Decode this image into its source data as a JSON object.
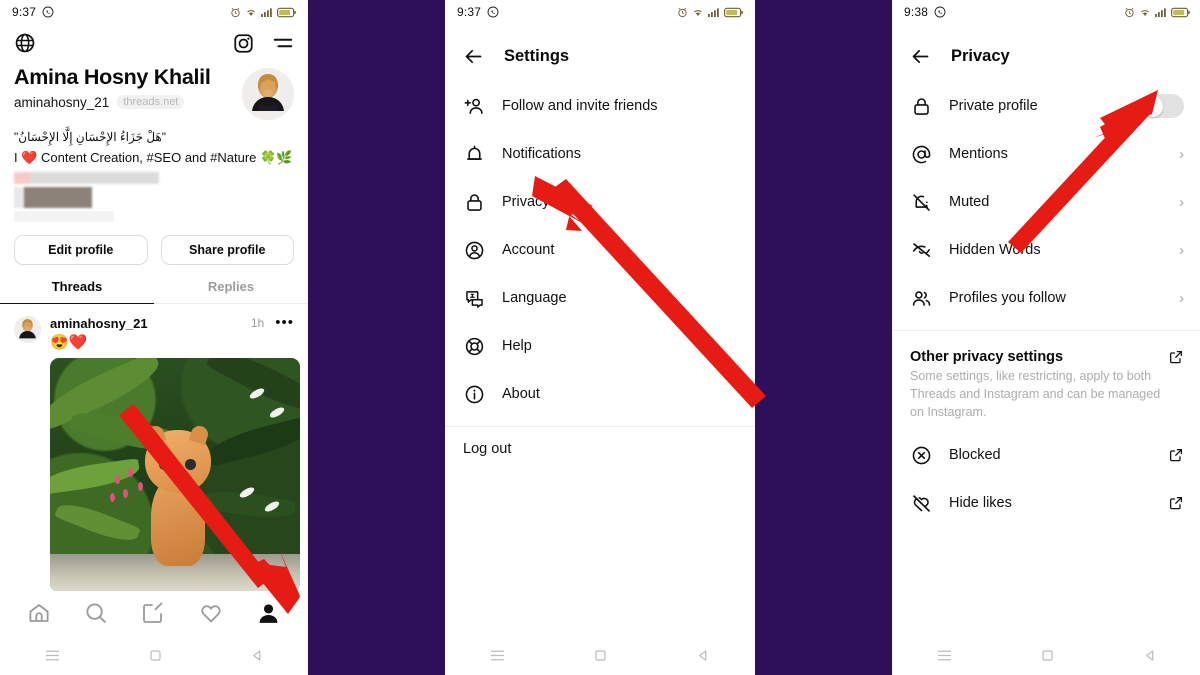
{
  "theme": {
    "background_purple": "#2d0f5a",
    "panel_white": "#ffffff",
    "arrow_red": "#e61b14",
    "accent_text": "#111111",
    "muted_text": "#adadad"
  },
  "panel_profile": {
    "status_bar": {
      "time": "9:37",
      "app_icon": "whatsapp-icon",
      "icons": [
        "alarm-icon",
        "wifi-icon",
        "signal-icon",
        "battery-icon"
      ]
    },
    "header": {
      "globe_icon": "globe-icon",
      "instagram_icon": "instagram-icon",
      "menu_icon": "hamburger-menu-icon"
    },
    "profile": {
      "display_name": "Amina Hosny Khalil",
      "username": "aminahosny_21",
      "domain_badge": "threads.net",
      "bio_arabic": "\"هَلْ جَزَاءُ الإِحْسَانِ إِلَّا الإِحْسَانُ\"",
      "bio_english": "I ❤️ Content Creation, #SEO and #Nature 🍀🌿",
      "avatar": "profile-avatar"
    },
    "buttons": {
      "edit_profile": "Edit profile",
      "share_profile": "Share profile"
    },
    "tabs": [
      {
        "label": "Threads",
        "active": true
      },
      {
        "label": "Replies",
        "active": false
      }
    ],
    "post": {
      "username": "aminahosny_21",
      "time": "1h",
      "more": "•••",
      "text": "😍❤️",
      "image": "kitten-in-garden-photo"
    },
    "bottom_nav": [
      {
        "name": "home-icon",
        "label": "Home"
      },
      {
        "name": "search-icon",
        "label": "Search"
      },
      {
        "name": "compose-icon",
        "label": "New thread"
      },
      {
        "name": "heart-icon",
        "label": "Activity"
      },
      {
        "name": "profile-icon",
        "label": "Profile"
      }
    ],
    "system_nav": [
      "recents-icon",
      "home-square-icon",
      "back-triangle-icon"
    ]
  },
  "panel_settings": {
    "status_bar": {
      "time": "9:37",
      "app_icon": "whatsapp-icon",
      "icons": [
        "alarm-icon",
        "wifi-icon",
        "signal-icon",
        "battery-icon"
      ]
    },
    "title": "Settings",
    "back_icon": "back-arrow-icon",
    "items": [
      {
        "label": "Follow and invite friends",
        "icon": "add-person-icon"
      },
      {
        "label": "Notifications",
        "icon": "bell-icon"
      },
      {
        "label": "Privacy",
        "icon": "lock-icon"
      },
      {
        "label": "Account",
        "icon": "account-circle-icon"
      },
      {
        "label": "Language",
        "icon": "language-icon"
      },
      {
        "label": "Help",
        "icon": "lifebuoy-icon"
      },
      {
        "label": "About",
        "icon": "info-circle-icon"
      }
    ],
    "log_out": "Log out",
    "system_nav": [
      "recents-icon",
      "home-square-icon",
      "back-triangle-icon"
    ]
  },
  "panel_privacy": {
    "status_bar": {
      "time": "9:38",
      "app_icon": "whatsapp-icon",
      "icons": [
        "alarm-icon",
        "wifi-icon",
        "signal-icon",
        "battery-icon"
      ]
    },
    "title": "Privacy",
    "back_icon": "back-arrow-icon",
    "items": [
      {
        "label": "Private profile",
        "icon": "lock-icon",
        "control": "toggle",
        "toggle_on": false
      },
      {
        "label": "Mentions",
        "icon": "at-sign-icon",
        "control": "chevron"
      },
      {
        "label": "Muted",
        "icon": "bell-muted-icon",
        "control": "chevron"
      },
      {
        "label": "Hidden Words",
        "icon": "eye-off-icon",
        "control": "chevron"
      },
      {
        "label": "Profiles you follow",
        "icon": "people-icon",
        "control": "chevron"
      }
    ],
    "other_section": {
      "title": "Other privacy settings",
      "description": "Some settings, like restricting, apply to both Threads and Instagram and can be managed on Instagram.",
      "external_icon": "external-link-icon",
      "items": [
        {
          "label": "Blocked",
          "icon": "blocked-circle-x-icon",
          "control": "external-link-icon"
        },
        {
          "label": "Hide likes",
          "icon": "heart-off-icon",
          "control": "external-link-icon"
        }
      ]
    },
    "chevron": "›",
    "system_nav": [
      "recents-icon",
      "home-square-icon",
      "back-triangle-icon"
    ]
  },
  "annotations": [
    {
      "name": "arrow-to-profile-tab",
      "points_to": "profile-icon in bottom nav"
    },
    {
      "name": "arrow-to-privacy",
      "points_to": "Privacy row in Settings"
    },
    {
      "name": "arrow-to-private-profile-toggle",
      "points_to": "Private profile toggle"
    }
  ]
}
